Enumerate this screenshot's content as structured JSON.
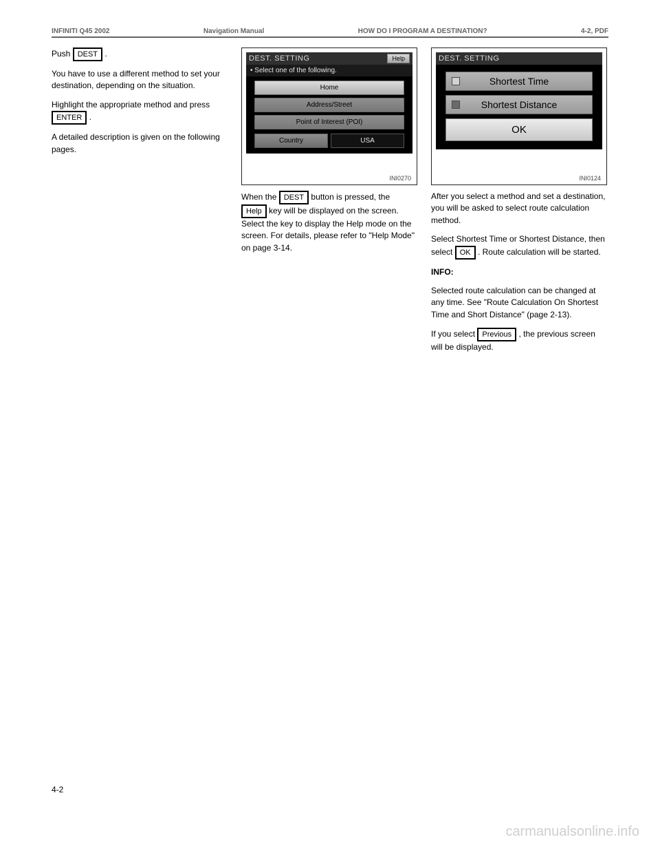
{
  "header": {
    "model": "INFINITI Q45 2002",
    "doc": "Navigation Manual",
    "section": "HOW DO I PROGRAM A DESTINATION?",
    "page": "4-2, PDF"
  },
  "page_num": "4-2",
  "col1": {
    "p1a": "Push ",
    "key_dest1": "DEST",
    "p1b": ".",
    "p2": "You have to use a different method to set your destination, depending on the situation.",
    "p3": "Highlight the appropriate method and press ",
    "key_enter1": "ENTER",
    "p3b": ".",
    "p4": "A detailed description is given on the following pages."
  },
  "fig1": {
    "title": "DEST. SETTING",
    "help": "Help",
    "sub": "• Select one of the following.",
    "btn_home": "Home",
    "btn_addr": "Address/Street",
    "btn_poi": "Point of Interest (POI)",
    "btn_country": "Country",
    "country_val": "USA",
    "tag": "INI0270"
  },
  "col2": {
    "p1a": "When the ",
    "key_dest2": "DEST",
    "p1b": " button is pressed, the ",
    "key_help": "Help",
    "p1c": " key will be displayed on the screen. Select the key to display the Help mode on the screen. For details, please refer to \"Help Mode\" on page 3-14."
  },
  "fig2": {
    "title": "DEST. SETTING",
    "opt1": "Shortest Time",
    "opt2": "Shortest Distance",
    "ok": "OK",
    "tag": "INI0124"
  },
  "col3": {
    "p1": "After you select a method and set a destination, you will be asked to select route calculation method.",
    "p2a": "Select Shortest Time or Shortest Distance, then select ",
    "key_ok": "OK",
    "p2b": ". Route calculation will be started.",
    "info_label": "INFO:",
    "info": "Selected route calculation can be changed at any time. See \"Route Calculation On Shortest Time and Short Distance\" (page 2-13).",
    "p3a": "If you select ",
    "key_previous": "Previous",
    "p3b": ", the previous screen will be displayed."
  },
  "watermark": "carmanualsonline.info"
}
